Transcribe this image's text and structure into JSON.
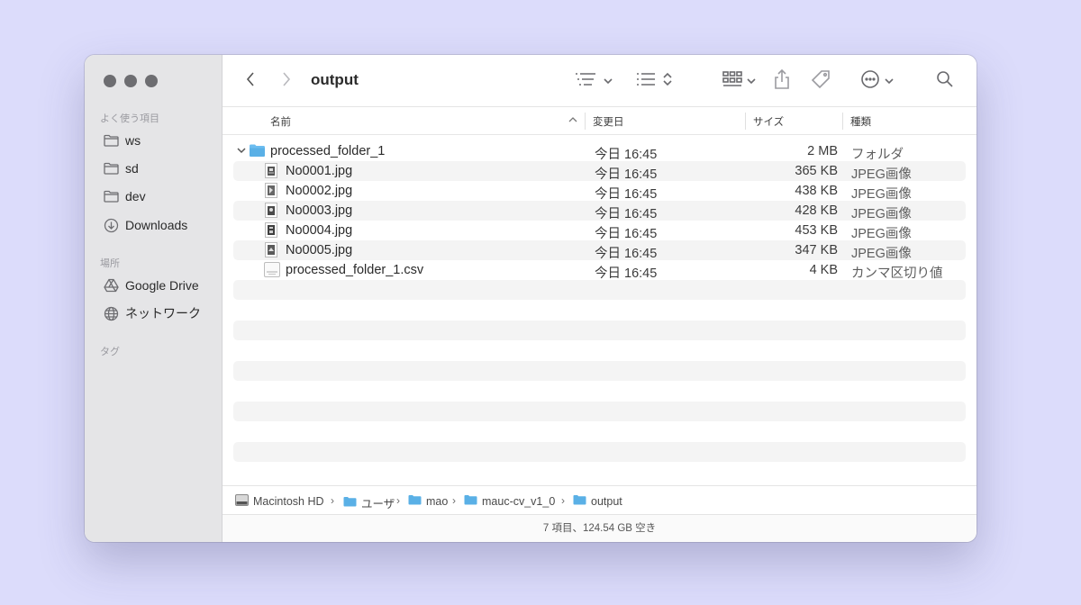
{
  "sidebar": {
    "favorites_label": "よく使う項目",
    "favorites": [
      {
        "label": "ws",
        "icon": "folder-icon"
      },
      {
        "label": "sd",
        "icon": "folder-icon"
      },
      {
        "label": "dev",
        "icon": "folder-icon"
      },
      {
        "label": "Downloads",
        "icon": "download-icon"
      }
    ],
    "locations_label": "場所",
    "locations": [
      {
        "label": "Google Drive",
        "icon": "drive-icon"
      },
      {
        "label": "ネットワーク",
        "icon": "globe-icon"
      }
    ],
    "tags_label": "タグ"
  },
  "toolbar": {
    "title": "output"
  },
  "columns": {
    "name": "名前",
    "modified": "変更日",
    "size": "サイズ",
    "kind": "種類"
  },
  "files": [
    {
      "name": "processed_folder_1",
      "date": "今日 16:45",
      "size": "2 MB",
      "kind": "フォルダ",
      "icon": "folder-icon",
      "expanded": true
    },
    {
      "name": "No0001.jpg",
      "date": "今日 16:45",
      "size": "365 KB",
      "kind": "JPEG画像",
      "icon": "image-thumbnail-icon"
    },
    {
      "name": "No0002.jpg",
      "date": "今日 16:45",
      "size": "438 KB",
      "kind": "JPEG画像",
      "icon": "image-thumbnail-icon"
    },
    {
      "name": "No0003.jpg",
      "date": "今日 16:45",
      "size": "428 KB",
      "kind": "JPEG画像",
      "icon": "image-thumbnail-icon"
    },
    {
      "name": "No0004.jpg",
      "date": "今日 16:45",
      "size": "453 KB",
      "kind": "JPEG画像",
      "icon": "image-thumbnail-icon"
    },
    {
      "name": "No0005.jpg",
      "date": "今日 16:45",
      "size": "347 KB",
      "kind": "JPEG画像",
      "icon": "image-thumbnail-icon"
    },
    {
      "name": "processed_folder_1.csv",
      "date": "今日 16:45",
      "size": "4 KB",
      "kind": "カンマ区切り値",
      "icon": "csv-file-icon"
    }
  ],
  "pathbar": {
    "items": [
      {
        "label": "Macintosh HD",
        "icon": "hard-drive-icon"
      },
      {
        "label": "ユーザ",
        "icon": "folder-icon"
      },
      {
        "label": "mao",
        "icon": "folder-icon"
      },
      {
        "label": "mauc-cv_v1_0",
        "icon": "folder-icon"
      },
      {
        "label": "output",
        "icon": "folder-icon"
      }
    ]
  },
  "status": {
    "text": "7 項目、124.54 GB 空き"
  },
  "colors": {
    "background": "#dcdcfb",
    "sidebar": "#e5e5e7",
    "folder": "#5ab0e6",
    "row_alt": "#f4f4f4"
  }
}
